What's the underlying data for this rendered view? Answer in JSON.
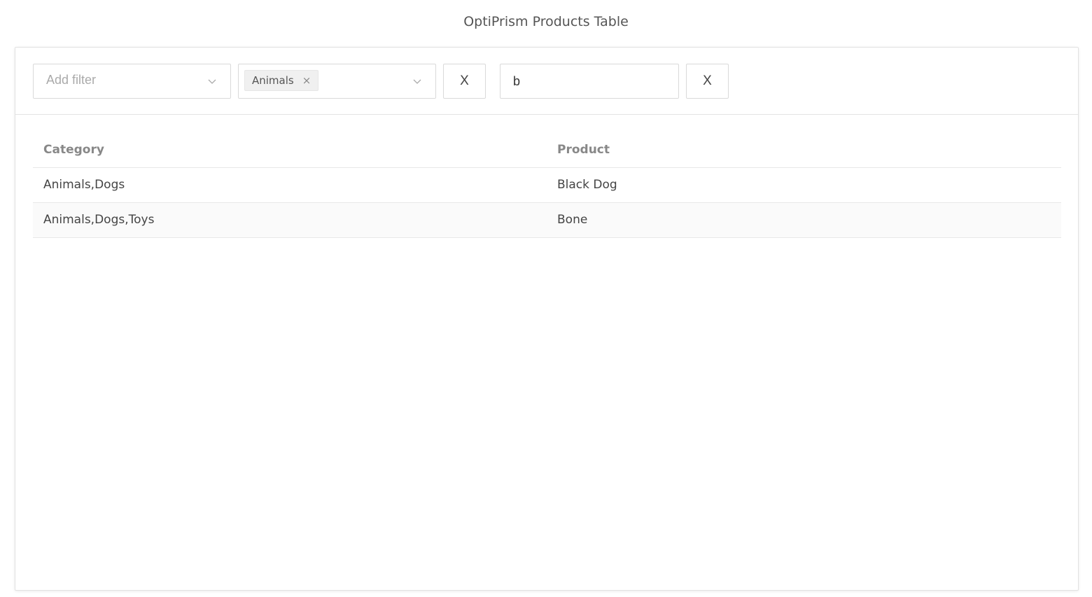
{
  "page": {
    "title": "OptiPrism Products Table"
  },
  "filters": {
    "add_filter_placeholder": "Add filter",
    "category_tags": [
      "Animals"
    ],
    "tag_close_glyph": "×",
    "clear_button_1": "X",
    "search_value": "b",
    "clear_button_2": "X"
  },
  "table": {
    "headers": [
      "Category",
      "Product"
    ],
    "rows": [
      [
        "Animals,Dogs",
        "Black Dog"
      ],
      [
        "Animals,Dogs,Toys",
        "Bone"
      ]
    ]
  },
  "icons": {
    "dropdown": "chevron-down-icon"
  },
  "colors": {
    "border": "#d9d9d9",
    "header_text": "#888888",
    "alt_row": "#fafafa"
  }
}
